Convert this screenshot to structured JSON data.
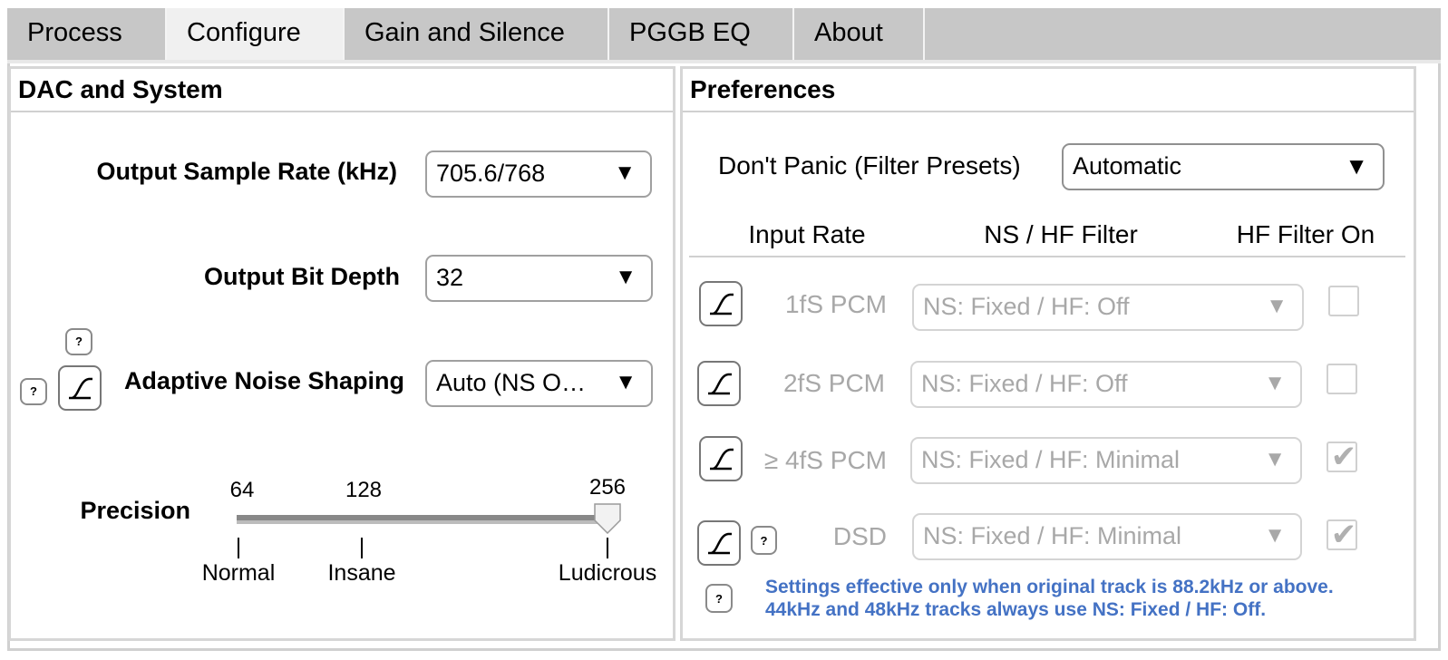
{
  "tabs": [
    {
      "label": "Process"
    },
    {
      "label": "Configure"
    },
    {
      "label": "Gain and Silence"
    },
    {
      "label": "PGGB EQ"
    },
    {
      "label": "About"
    }
  ],
  "active_tab": "Configure",
  "dac": {
    "title": "DAC and System",
    "output_sample_rate": {
      "label": "Output Sample Rate (kHz)",
      "value": "705.6/768"
    },
    "output_bit_depth": {
      "label": "Output Bit Depth",
      "value": "32"
    },
    "adaptive_noise_shaping": {
      "label": "Adaptive Noise Shaping",
      "value": "Auto (NS O…"
    },
    "help_glyph": "?",
    "precision": {
      "label": "Precision",
      "level": 256,
      "ticks": [
        {
          "value": "64",
          "name": "Normal"
        },
        {
          "value": "128",
          "name": "Insane"
        },
        {
          "value": "256",
          "name": "Ludicrous"
        }
      ]
    }
  },
  "prefs": {
    "title": "Preferences",
    "dont_panic": {
      "label": "Don't Panic (Filter Presets)",
      "value": "Automatic"
    },
    "columns": {
      "input_rate": "Input Rate",
      "filter": "NS / HF Filter",
      "hf_on": "HF Filter On"
    },
    "rows": [
      {
        "rate": "1fS PCM",
        "filter": "NS: Fixed / HF: Off",
        "hf_on": false
      },
      {
        "rate": "2fS PCM",
        "filter": "NS: Fixed / HF: Off",
        "hf_on": false
      },
      {
        "rate": "≥ 4fS PCM",
        "filter": "NS: Fixed / HF: Minimal",
        "hf_on": true
      },
      {
        "rate": "DSD",
        "filter": "NS: Fixed / HF: Minimal",
        "hf_on": true
      }
    ],
    "note_line1": "Settings effective only when original track is 88.2kHz or above.",
    "note_line2": "44kHz and 48kHz tracks always use NS: Fixed / HF: Off.",
    "check_glyph": "✔"
  },
  "icons": {
    "dropdown_arrow": "▼",
    "filter": "filter-curve-icon",
    "help": "help-icon"
  },
  "colors": {
    "note": "#4472c4",
    "disabled_text": "#a8a8a8"
  }
}
